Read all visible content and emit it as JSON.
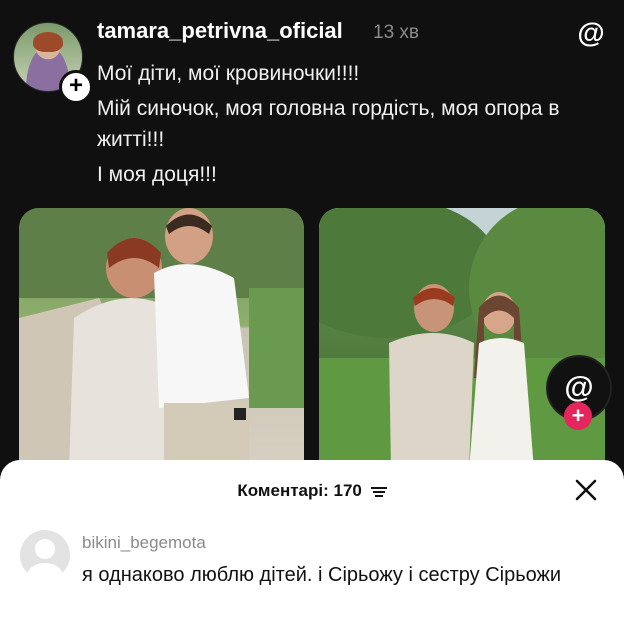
{
  "post": {
    "username": "tamara_petrivna_oficial",
    "time": "13 хв",
    "caption": [
      "Мої діти, мої кровиночки!!!!",
      "Мій синочок, моя головна гордість, моя опора в житті!!!",
      "І моя доця!!!"
    ],
    "follow_symbol": "+",
    "threads_symbol": "@"
  },
  "comments_sheet": {
    "title": "Коментарі: 170",
    "comment": {
      "username": "bikini_begemota",
      "text": "я однаково люблю дітей. і Сірьожу і сестру Сірьожи"
    }
  },
  "colors": {
    "background": "#101010",
    "sheet": "#ffffff",
    "fab_plus": "#e5255c"
  }
}
